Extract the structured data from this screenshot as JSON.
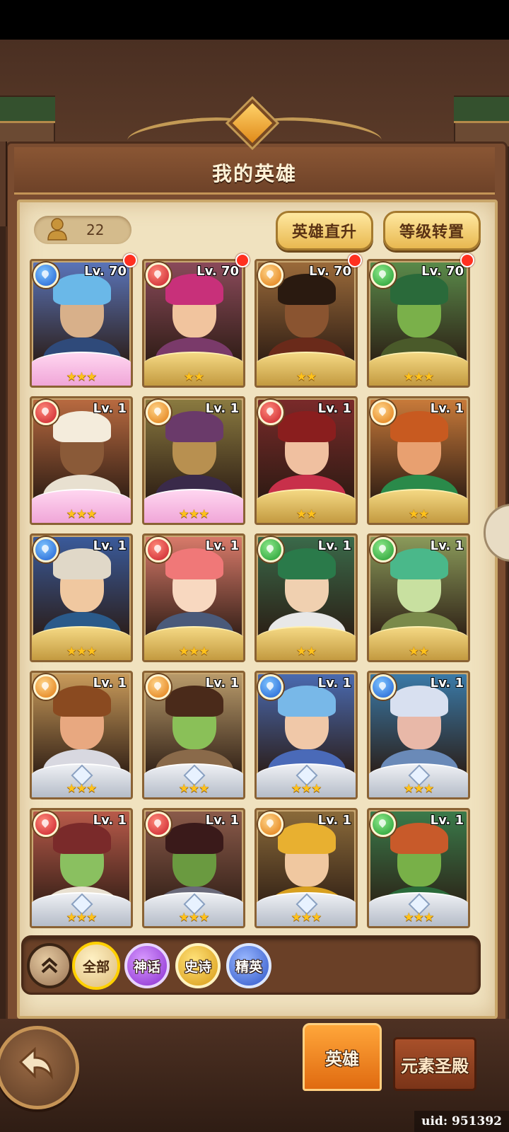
{
  "title": "我的英雄",
  "hero_count": "22",
  "buttons": {
    "upgrade": "英雄直升",
    "transfer": "等级转置"
  },
  "filters": {
    "all": "全部",
    "myth": "神话",
    "epic": "史诗",
    "elite": "精英"
  },
  "tabs": {
    "heroes": "英雄",
    "shrine": "元素圣殿"
  },
  "uid": "uid: 951392",
  "heroes": [
    {
      "level": "Lv. 70",
      "stars": "★★★",
      "element": "water",
      "rarity": "mythic",
      "new": true,
      "skin": "#d8b08a",
      "hair": "#6ab8e8",
      "body": "#2f4a7a",
      "bg": "#5a74b8"
    },
    {
      "level": "Lv. 70",
      "stars": "★★",
      "element": "fire",
      "rarity": "gold",
      "new": true,
      "skin": "#f1c49e",
      "hair": "#c8307a",
      "body": "#7a3a6a",
      "bg": "#8a4a5a"
    },
    {
      "level": "Lv. 70",
      "stars": "★★",
      "element": "light",
      "rarity": "gold",
      "new": true,
      "skin": "#8a5430",
      "hair": "#2a1a10",
      "body": "#6a2a1a",
      "bg": "#9a6a3a"
    },
    {
      "level": "Lv. 70",
      "stars": "★★★",
      "element": "nature",
      "rarity": "gold",
      "new": true,
      "skin": "#7ab04a",
      "hair": "#2a6a3a",
      "body": "#4a5a2a",
      "bg": "#5a8a4a"
    },
    {
      "level": "Lv. 1",
      "stars": "★★★",
      "element": "fire",
      "rarity": "mythic",
      "new": false,
      "skin": "#8a5a38",
      "hair": "#f4ecdc",
      "body": "#e8e0d0",
      "bg": "#b86a40"
    },
    {
      "level": "Lv. 1",
      "stars": "★★★",
      "element": "light",
      "rarity": "mythic",
      "new": false,
      "skin": "#b89050",
      "hair": "#6a3a6a",
      "body": "#3a2a4a",
      "bg": "#8a7a40"
    },
    {
      "level": "Lv. 1",
      "stars": "★★",
      "element": "fire",
      "rarity": "gold",
      "new": false,
      "skin": "#f0c0a0",
      "hair": "#8a1e1e",
      "body": "#c8304a",
      "bg": "#7a2a2a"
    },
    {
      "level": "Lv. 1",
      "stars": "★★",
      "element": "light",
      "rarity": "gold",
      "new": false,
      "skin": "#e8a070",
      "hair": "#c85a20",
      "body": "#2a8a4a",
      "bg": "#c87a3a"
    },
    {
      "level": "Lv. 1",
      "stars": "★★★",
      "element": "water",
      "rarity": "gold",
      "new": false,
      "skin": "#f0c8a0",
      "hair": "#e0d8c8",
      "body": "#2a5a8a",
      "bg": "#3a5a9a"
    },
    {
      "level": "Lv. 1",
      "stars": "★★★",
      "element": "fire",
      "rarity": "gold",
      "new": false,
      "skin": "#f8d8c0",
      "hair": "#f07878",
      "body": "#4a5a7a",
      "bg": "#d87a6a"
    },
    {
      "level": "Lv. 1",
      "stars": "★★",
      "element": "nature",
      "rarity": "gold",
      "new": false,
      "skin": "#f0d0b0",
      "hair": "#2a7a4a",
      "body": "#e8e8e8",
      "bg": "#3a6a4a"
    },
    {
      "level": "Lv. 1",
      "stars": "★★",
      "element": "nature",
      "rarity": "gold",
      "new": false,
      "skin": "#c8e0a0",
      "hair": "#4ab88a",
      "body": "#7a8a4a",
      "bg": "#8a9a5a"
    },
    {
      "level": "Lv. 1",
      "stars": "★★★",
      "element": "light",
      "rarity": "silver",
      "new": false,
      "skin": "#e8a880",
      "hair": "#8a4a20",
      "body": "#d8d8e0",
      "bg": "#c89a5a"
    },
    {
      "level": "Lv. 1",
      "stars": "★★★",
      "element": "light",
      "rarity": "silver",
      "new": false,
      "skin": "#8ac058",
      "hair": "#4a2a1a",
      "body": "#8a6a4a",
      "bg": "#b89a6a"
    },
    {
      "level": "Lv. 1",
      "stars": "★★★",
      "element": "water",
      "rarity": "silver",
      "new": false,
      "skin": "#f0c8a8",
      "hair": "#78b8e8",
      "body": "#4a6ab8",
      "bg": "#4a6ab0"
    },
    {
      "level": "Lv. 1",
      "stars": "★★★",
      "element": "water",
      "rarity": "silver",
      "new": false,
      "skin": "#e8b8a8",
      "hair": "#d8e0f0",
      "body": "#6a8ab8",
      "bg": "#3a7aa8"
    },
    {
      "level": "Lv. 1",
      "stars": "★★★",
      "element": "fire",
      "rarity": "silver",
      "new": false,
      "skin": "#8ac060",
      "hair": "#7a2a2a",
      "body": "#e8e0d0",
      "bg": "#b85a4a"
    },
    {
      "level": "Lv. 1",
      "stars": "★★★",
      "element": "fire",
      "rarity": "silver",
      "new": false,
      "skin": "#6a9a40",
      "hair": "#3a1a1a",
      "body": "#6a6a7a",
      "bg": "#8a5a4a"
    },
    {
      "level": "Lv. 1",
      "stars": "★★★",
      "element": "light",
      "rarity": "silver",
      "new": false,
      "skin": "#f0c8a0",
      "hair": "#e8b030",
      "body": "#d8a020",
      "bg": "#8a6a3a"
    },
    {
      "level": "Lv. 1",
      "stars": "★★★",
      "element": "nature",
      "rarity": "silver",
      "new": false,
      "skin": "#78b048",
      "hair": "#c85a2a",
      "body": "#2a6a3a",
      "bg": "#3a7a4a"
    }
  ]
}
